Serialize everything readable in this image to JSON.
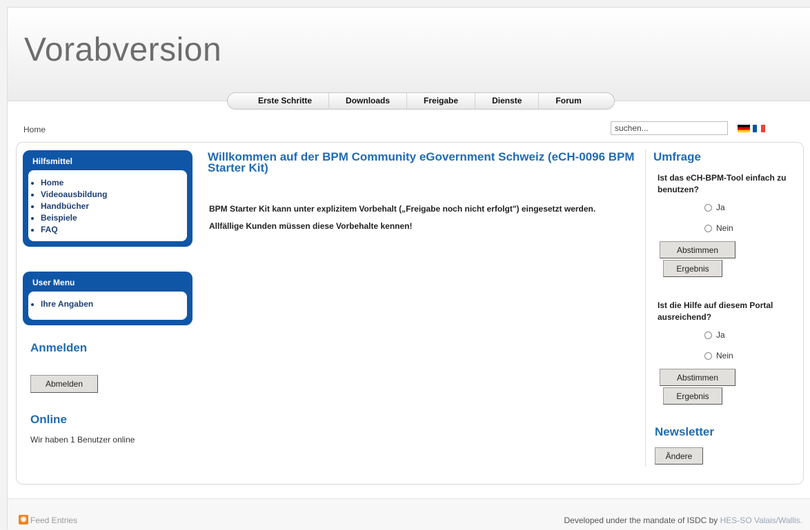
{
  "site": {
    "title": "Vorabversion"
  },
  "nav": [
    "Erste Schritte",
    "Downloads",
    "Freigabe",
    "Dienste",
    "Forum"
  ],
  "breadcrumb": "Home",
  "search": {
    "placeholder": "suchen..."
  },
  "sidebar": {
    "hilfsmittel": {
      "title": "Hilfsmittel",
      "items": [
        "Home",
        "Videoausbildung",
        "Handbücher",
        "Beispiele",
        "FAQ"
      ]
    },
    "user_menu": {
      "title": "User Menu",
      "items": [
        "Ihre Angaben"
      ]
    },
    "login": {
      "title": "Anmelden",
      "button": "Abmelden"
    },
    "online": {
      "title": "Online",
      "text": "Wir haben 1 Benutzer online"
    }
  },
  "main": {
    "title": "Willkommen auf der BPM Community eGovernment Schweiz (eCH-0096 BPM Starter Kit)",
    "paragraphs": [
      "BPM Starter Kit kann unter explizitem Vorbehalt („Freigabe noch nicht erfolgt\") eingesetzt werden.",
      "Allfällige Kunden müssen diese Vorbehalte kennen!"
    ]
  },
  "poll": {
    "title": "Umfrage",
    "q1": "Ist das eCH-BPM-Tool einfach zu benutzen?",
    "q2": "Ist die Hilfe auf diesem Portal ausreichend?",
    "opt_yes": "Ja",
    "opt_no": "Nein",
    "vote": "Abstimmen",
    "result": "Ergebnis"
  },
  "newsletter": {
    "title": "Newsletter",
    "button": "Ändere"
  },
  "footer": {
    "feed": "Feed Entries",
    "dev_prefix": "Developed under the mandate of ISDC by ",
    "dev_link": "HES-SO Valais/Wallis."
  }
}
